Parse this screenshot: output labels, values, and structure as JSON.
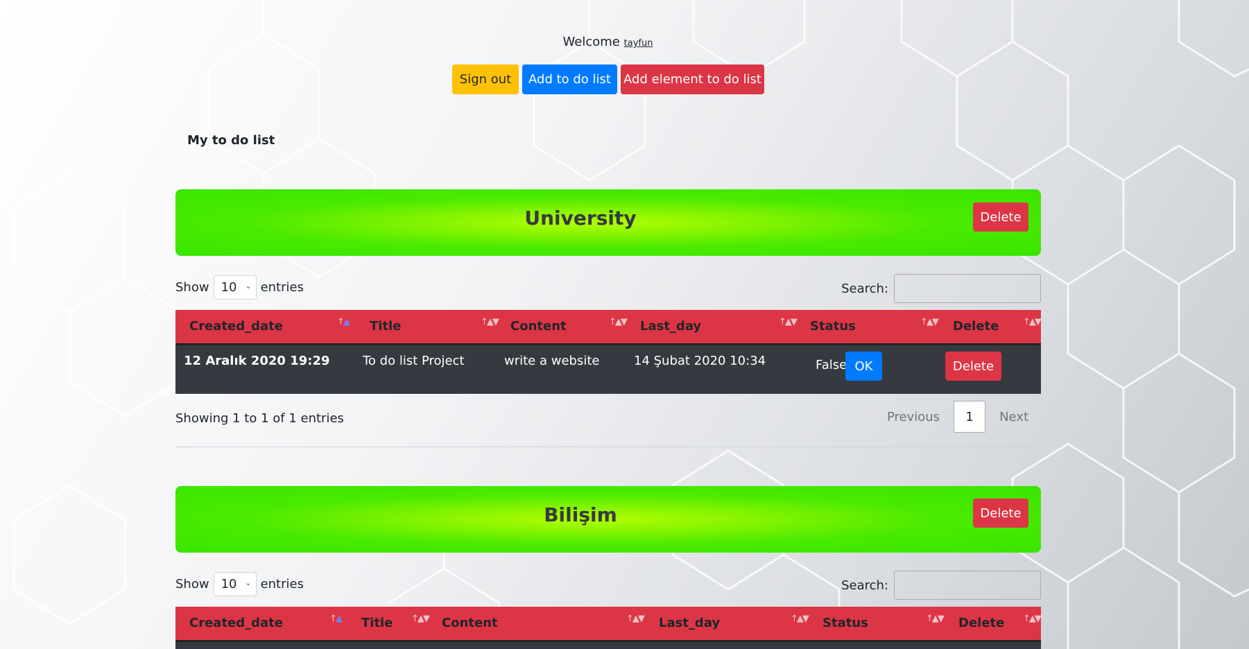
{
  "header": {
    "welcome_text": "Welcome",
    "username": "tayfun",
    "sign_out_label": "Sign out",
    "add_list_label": "Add to do list",
    "add_element_label": "Add element to do list"
  },
  "page_title": "My to do list",
  "colors": {
    "warning": "#ffc107",
    "primary": "#007bff",
    "danger": "#dc3545",
    "banner_green": "#38e600",
    "banner_lime": "#b2ff00",
    "row_dark": "#343a40"
  },
  "lists": [
    {
      "name": "University",
      "delete_label": "Delete",
      "show_label": "Show",
      "entries_label": "entries",
      "page_length": "10",
      "search_label": "Search:",
      "columns": [
        "Created_date",
        "Title",
        "Content",
        "Last_day",
        "Status",
        "Delete"
      ],
      "rows": [
        {
          "created_date": "12 Aralık 2020 19:29",
          "title": "To do list Project",
          "content": "write a website",
          "last_day": "14 Şubat 2020 10:34",
          "status": "False",
          "ok_label": "OK",
          "delete_label": "Delete"
        }
      ],
      "info": "Showing 1 to 1 of 1 entries",
      "previous_label": "Previous",
      "current_page": "1",
      "next_label": "Next"
    },
    {
      "name": "Bilişim",
      "delete_label": "Delete",
      "show_label": "Show",
      "entries_label": "entries",
      "page_length": "10",
      "search_label": "Search:",
      "columns": [
        "Created_date",
        "Title",
        "Content",
        "Last_day",
        "Status",
        "Delete"
      ]
    }
  ]
}
